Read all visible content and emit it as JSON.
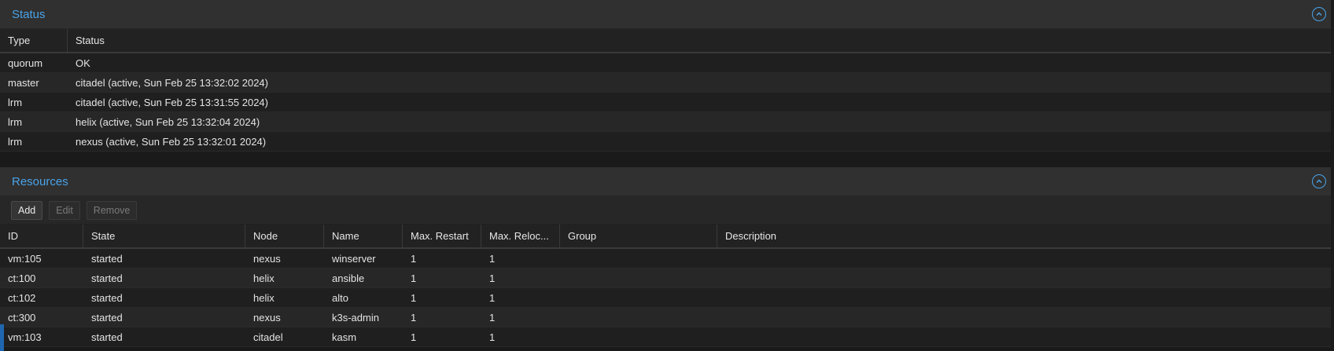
{
  "status": {
    "title": "Status",
    "collapse_icon": "chevron-up-icon",
    "columns": [
      "Type",
      "Status"
    ],
    "rows": [
      [
        "quorum",
        "OK"
      ],
      [
        "master",
        "citadel (active, Sun Feb 25 13:32:02 2024)"
      ],
      [
        "lrm",
        "citadel (active, Sun Feb 25 13:31:55 2024)"
      ],
      [
        "lrm",
        "helix (active, Sun Feb 25 13:32:04 2024)"
      ],
      [
        "lrm",
        "nexus (active, Sun Feb 25 13:32:01 2024)"
      ]
    ]
  },
  "resources": {
    "title": "Resources",
    "collapse_icon": "chevron-up-icon",
    "toolbar": {
      "add": "Add",
      "edit": "Edit",
      "remove": "Remove"
    },
    "columns": [
      "ID",
      "State",
      "Node",
      "Name",
      "Max. Restart",
      "Max. Reloc...",
      "Group",
      "Description"
    ],
    "rows": [
      [
        "vm:105",
        "started",
        "nexus",
        "winserver",
        "1",
        "1",
        "",
        ""
      ],
      [
        "ct:100",
        "started",
        "helix",
        "ansible",
        "1",
        "1",
        "",
        ""
      ],
      [
        "ct:102",
        "started",
        "helix",
        "alto",
        "1",
        "1",
        "",
        ""
      ],
      [
        "ct:300",
        "started",
        "nexus",
        "k3s-admin",
        "1",
        "1",
        "",
        ""
      ],
      [
        "vm:103",
        "started",
        "citadel",
        "kasm",
        "1",
        "1",
        "",
        ""
      ]
    ]
  },
  "colors": {
    "accent": "#4aa3e8",
    "background": "#1a1a1a",
    "header": "#303030"
  }
}
